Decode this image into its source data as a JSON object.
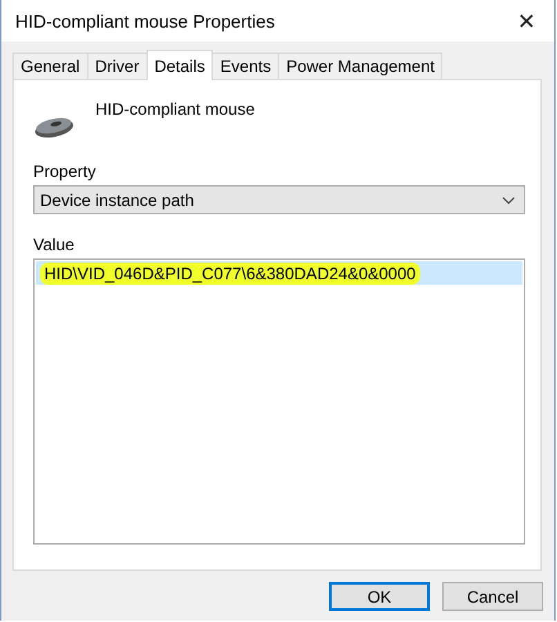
{
  "window": {
    "title": "HID-compliant mouse Properties",
    "close": "✕"
  },
  "tabs": [
    {
      "label": "General",
      "selected": false
    },
    {
      "label": "Driver",
      "selected": false
    },
    {
      "label": "Details",
      "selected": true
    },
    {
      "label": "Events",
      "selected": false
    },
    {
      "label": "Power Management",
      "selected": false
    }
  ],
  "device": {
    "name": "HID-compliant mouse"
  },
  "property": {
    "label": "Property",
    "value": "Device instance path"
  },
  "value": {
    "label": "Value",
    "rows": [
      {
        "text": "HID\\VID_046D&PID_C077\\6&380DAD24&0&0000",
        "selected": true,
        "highlighted": true
      }
    ]
  },
  "buttons": [
    {
      "label": "OK",
      "default": true
    },
    {
      "label": "Cancel",
      "default": false
    }
  ]
}
